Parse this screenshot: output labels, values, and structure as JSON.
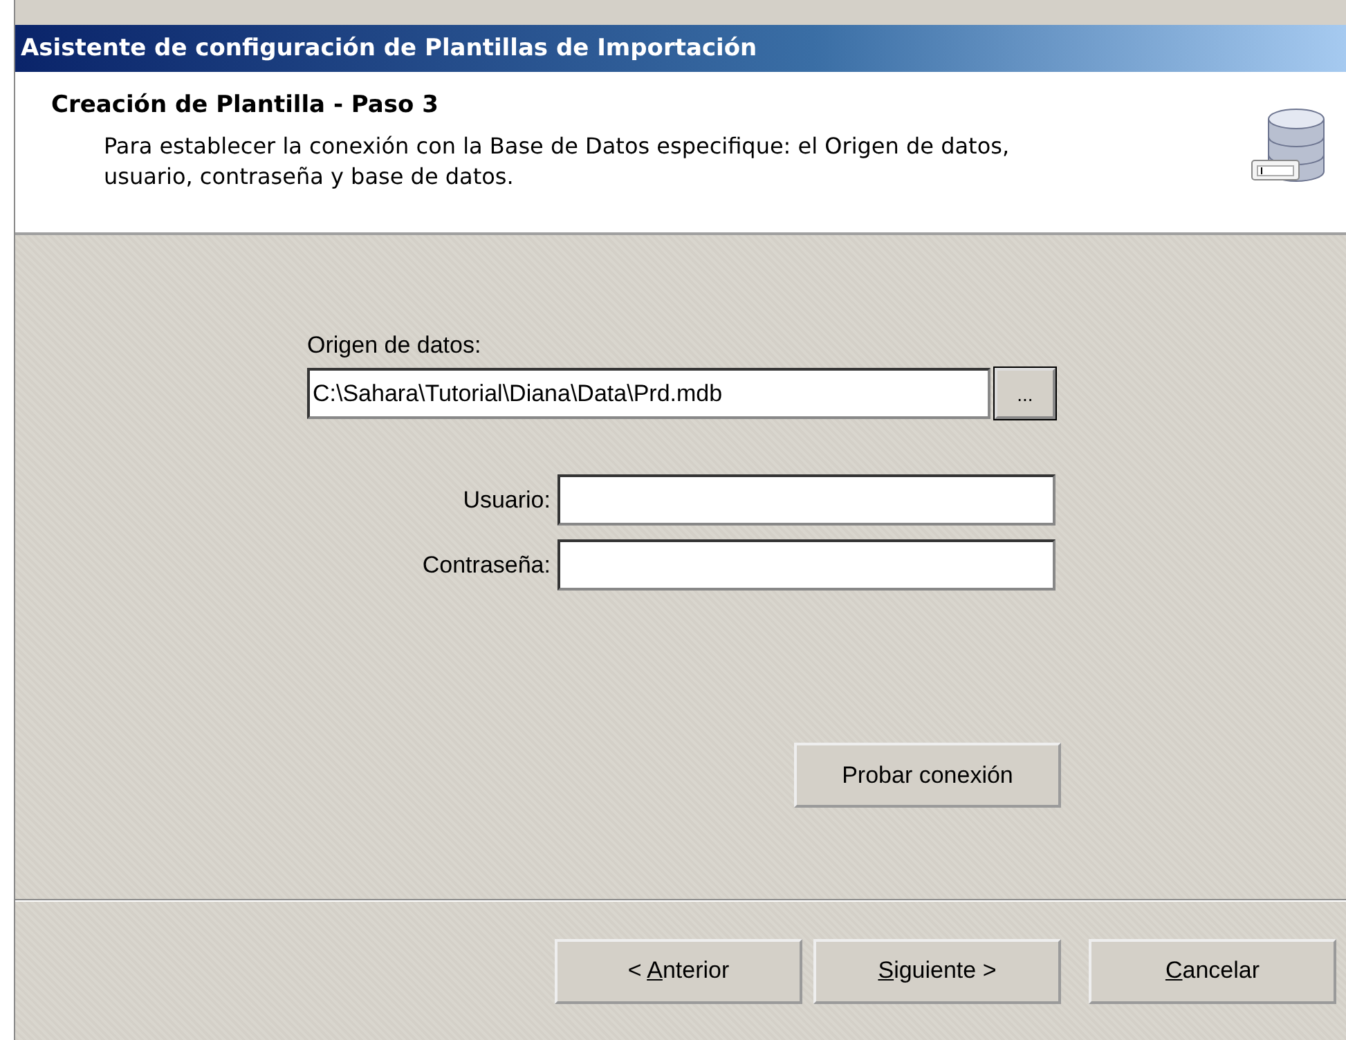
{
  "window": {
    "title": "Asistente de configuración de Plantillas de Importación"
  },
  "header": {
    "title": "Creación de Plantilla - Paso 3",
    "description": "Para establecer la conexión con la Base de Datos especifique: el Origen de datos, usuario, contraseña y base de datos."
  },
  "source": {
    "label": "Origen de datos:",
    "value": "C:\\Sahara\\Tutorial\\Diana\\Data\\Prd.mdb",
    "browse": "..."
  },
  "fields": [
    {
      "label": "Usuario:"
    },
    {
      "label": "Contraseña:"
    }
  ],
  "test_button": "Probar conexión",
  "buttons": [
    {
      "prefix": "< ",
      "key": "A",
      "rest": "nterior"
    },
    {
      "key": "S",
      "rest": "iguiente >"
    },
    {
      "key": "C",
      "rest": "ancelar"
    }
  ]
}
